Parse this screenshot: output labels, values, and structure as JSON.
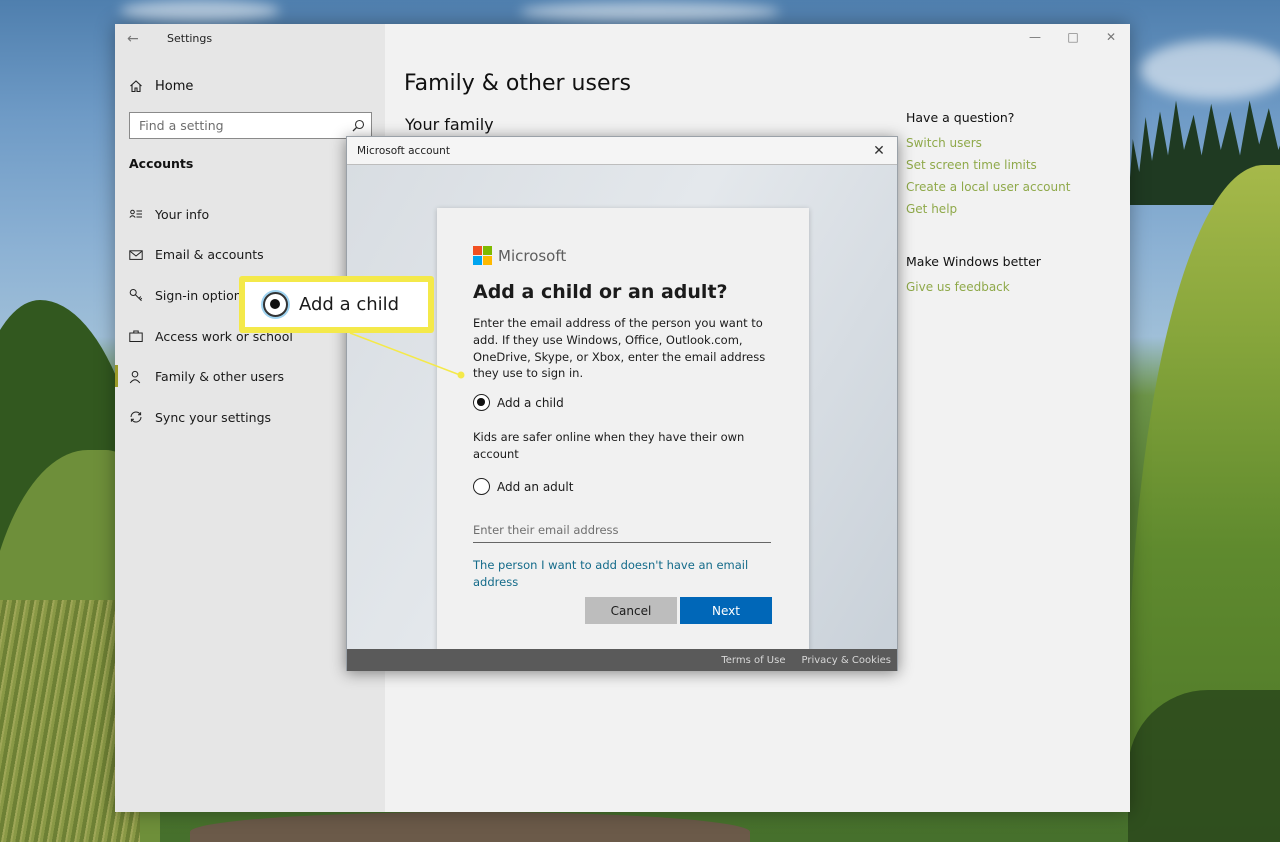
{
  "settings": {
    "window_title": "Settings",
    "home_label": "Home",
    "search_placeholder": "Find a setting",
    "section_heading": "Accounts",
    "nav_items": [
      {
        "label": "Your info",
        "icon": "person-card-icon"
      },
      {
        "label": "Email & accounts",
        "icon": "envelope-icon"
      },
      {
        "label": "Sign-in options",
        "icon": "key-icon"
      },
      {
        "label": "Access work or school",
        "icon": "briefcase-icon"
      },
      {
        "label": "Family & other users",
        "icon": "person-icon",
        "selected": true
      },
      {
        "label": "Sync your settings",
        "icon": "sync-icon"
      }
    ],
    "page_title": "Family & other users",
    "subheading": "Your family",
    "help_heading": "Have a question?",
    "help_links": [
      "Switch users",
      "Set screen time limits",
      "Create a local user account",
      "Get help"
    ],
    "feedback_heading": "Make Windows better",
    "feedback_link": "Give us feedback",
    "accent_color": "#9a9a28",
    "link_color": "#8fa94a"
  },
  "dialog": {
    "title": "Microsoft account",
    "brand": "Microsoft",
    "heading": "Add a child or an adult?",
    "description": "Enter the email address of the person you want to add. If they use Windows, Office, Outlook.com, OneDrive, Skype, or Xbox, enter the email address they use to sign in.",
    "option_child": "Add a child",
    "option_child_selected": true,
    "kids_note": "Kids are safer online when they have their own account",
    "option_adult": "Add an adult",
    "email_placeholder": "Enter their email address",
    "no_email_link": "The person I want to add doesn't have an email address",
    "cancel_label": "Cancel",
    "next_label": "Next",
    "footer_terms": "Terms of Use",
    "footer_privacy": "Privacy & Cookies",
    "primary_color": "#0067b8",
    "logo_colors": [
      "#f25022",
      "#7fba00",
      "#00a4ef",
      "#ffb900"
    ]
  },
  "callout": {
    "label": "Add a child",
    "frame_color": "#f4e94a"
  }
}
